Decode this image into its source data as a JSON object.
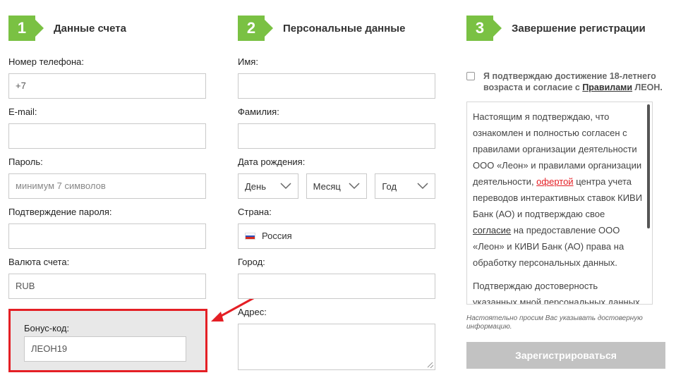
{
  "steps": [
    {
      "number": "1",
      "title": "Данные счета"
    },
    {
      "number": "2",
      "title": "Персональные данные"
    },
    {
      "number": "3",
      "title": "Завершение регистрации"
    }
  ],
  "account": {
    "phone_label": "Номер телефона:",
    "phone_value": "+7",
    "email_label": "E-mail:",
    "email_value": "",
    "password_label": "Пароль:",
    "password_placeholder": "минимум 7 символов",
    "confirm_label": "Подтверждение пароля:",
    "confirm_value": "",
    "currency_label": "Валюта счета:",
    "currency_value": "RUB",
    "bonus_label": "Бонус-код:",
    "bonus_value": "ЛЕОН19"
  },
  "personal": {
    "name_label": "Имя:",
    "surname_label": "Фамилия:",
    "birth_label": "Дата рождения:",
    "day": "День",
    "month": "Месяц",
    "year": "Год",
    "country_label": "Страна:",
    "country_value": "Россия",
    "city_label": "Город:",
    "address_label": "Адрес:"
  },
  "finish": {
    "agree_text_1": "Я подтверждаю достижение 18-летнего возраста и согласие с ",
    "agree_link": "Правилами",
    "agree_text_2": " ЛЕОН.",
    "terms_p1_a": "Настоящим я подтверждаю, что ознакомлен и полностью согласен с правилами организации деятельности ООО «Леон» и правилами организации деятельности, ",
    "terms_offer": "офертой",
    "terms_p1_b": " центра учета переводов интерактивных ставок КИВИ Банк (АО) и подтверждаю свое ",
    "terms_consent": "согласие",
    "terms_p1_c": " на предоставление ООО «Леон» и КИВИ Банк (АО) права на обработку персональных данных.",
    "terms_p2": "Подтверждаю достоверность указанных мной персональных данных.",
    "note": "Настоятельно просим Вас указывать достоверную информацию.",
    "submit_label": "Зарегистрироваться"
  },
  "colors": {
    "accent_green": "#7ac143",
    "highlight_red": "#e41f25",
    "button_disabled": "#c2c2c2"
  }
}
